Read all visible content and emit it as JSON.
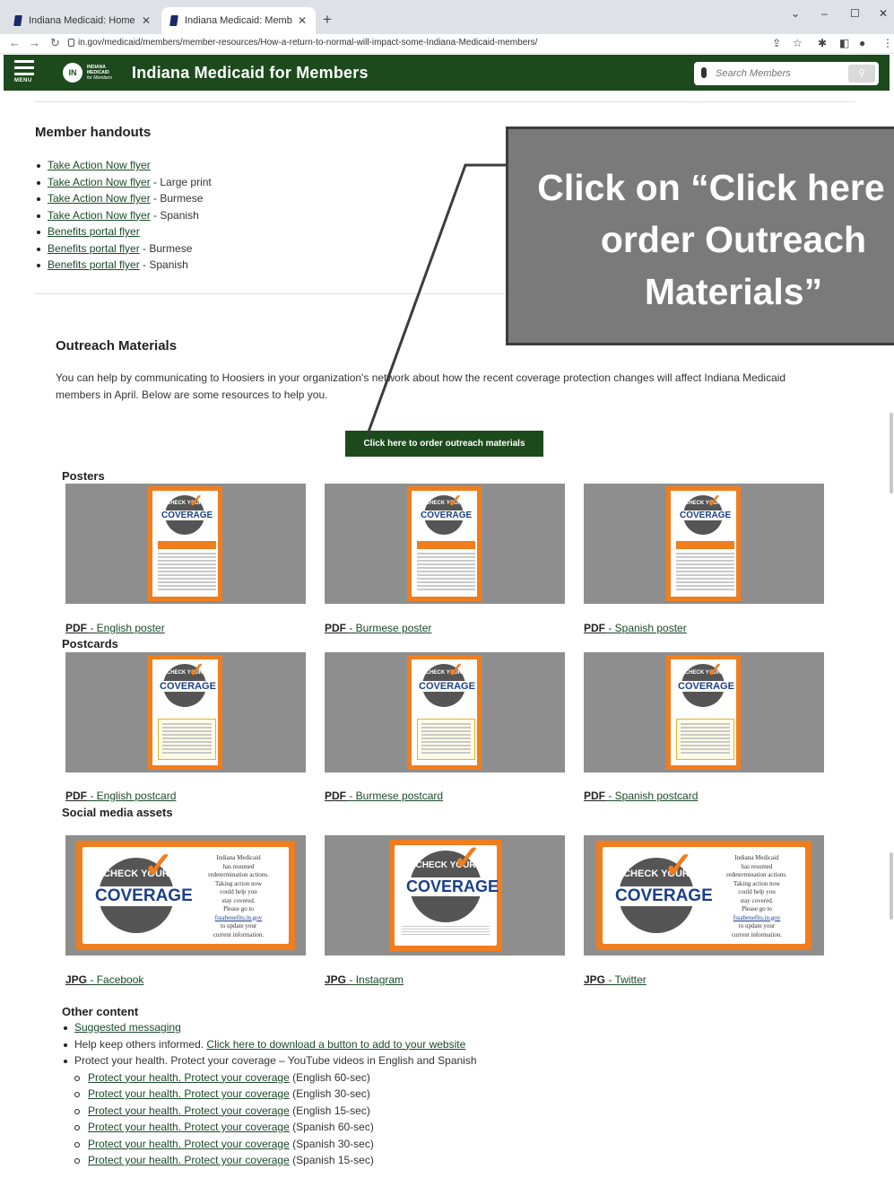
{
  "browser": {
    "tabs": [
      {
        "title": "Indiana Medicaid: Home"
      },
      {
        "title": "Indiana Medicaid: Members: Ho"
      }
    ],
    "url": "in.gov/medicaid/members/member-resources/How-a-return-to-normal-will-impact-some-Indiana-Medicaid-members/"
  },
  "header": {
    "menu_label": "MENU",
    "logo_lines": [
      "INDIANA",
      "MEDICAID",
      "for Members"
    ],
    "title": "Indiana Medicaid for Members",
    "search_placeholder": "Search Members"
  },
  "member_handouts": {
    "heading": "Member handouts",
    "items": [
      {
        "link": "Take Action Now flyer",
        "suffix": ""
      },
      {
        "link": "Take Action Now flyer",
        "suffix": " - Large print"
      },
      {
        "link": "Take Action Now flyer",
        "suffix": " - Burmese"
      },
      {
        "link": "Take Action Now flyer",
        "suffix": " - Spanish"
      },
      {
        "link": "Benefits portal flyer",
        "suffix": ""
      },
      {
        "link": "Benefits portal flyer",
        "suffix": " - Burmese"
      },
      {
        "link": "Benefits portal flyer",
        "suffix": " - Spanish"
      }
    ]
  },
  "outreach": {
    "heading": "Outreach Materials",
    "paragraph": "You can help by communicating to Hoosiers in your organization's network about how the recent coverage protection changes will affect Indiana Medicaid members in April. Below are some resources to help you.",
    "order_button": "Click here to order outreach materials"
  },
  "posters": {
    "heading": "Posters",
    "badge_top": "CHECK YOUR",
    "badge_word": "COVERAGE",
    "captions": [
      {
        "type": "PDF",
        "label": "English poster"
      },
      {
        "type": "PDF",
        "label": "Burmese poster"
      },
      {
        "type": "PDF",
        "label": "Spanish poster"
      }
    ]
  },
  "postcards": {
    "heading": "Postcards",
    "captions": [
      {
        "type": "PDF",
        "label": "English postcard"
      },
      {
        "type": "PDF",
        "label": "Burmese postcard"
      },
      {
        "type": "PDF",
        "label": "Spanish postcard"
      }
    ]
  },
  "social": {
    "heading": "Social media assets",
    "card_lines": [
      "Indiana Medicaid",
      "has resumed",
      "redetermination actions.",
      "Taking action now",
      "could help you",
      "stay covered.",
      "Please go to"
    ],
    "card_link": "fssabenefits.in.gov",
    "card_tail": [
      "to update your",
      "current information."
    ],
    "captions": [
      {
        "type": "JPG",
        "label": "Facebook"
      },
      {
        "type": "JPG",
        "label": "Instagram"
      },
      {
        "type": "JPG",
        "label": "Twitter"
      }
    ]
  },
  "other": {
    "heading": "Other content",
    "suggested": "Suggested messaging",
    "help_prefix": "Help keep others informed. ",
    "help_link": "Click here to download a button to add to your website",
    "videos_intro": "Protect your health. Protect your coverage – YouTube videos in English and Spanish",
    "videos": [
      {
        "link": "Protect your health. Protect your coverage",
        "suffix": " (English 60-sec)"
      },
      {
        "link": "Protect your health. Protect your coverage",
        "suffix": " (English 30-sec)"
      },
      {
        "link": "Protect your health. Protect your coverage",
        "suffix": " (English 15-sec)"
      },
      {
        "link": "Protect your health. Protect your coverage",
        "suffix": " (Spanish 60-sec)"
      },
      {
        "link": "Protect your health. Protect your coverage",
        "suffix": " (Spanish 30-sec)"
      },
      {
        "link": "Protect your health. Protect your coverage",
        "suffix": " (Spanish 15-sec)"
      }
    ]
  },
  "callout": {
    "lines": [
      "Click on “Click here to",
      "order Outreach",
      "Materials”"
    ]
  },
  "colors": {
    "header_green": "#1d4a1d",
    "accent_orange": "#f07d1e",
    "callout_gray": "#7a7a7a"
  }
}
